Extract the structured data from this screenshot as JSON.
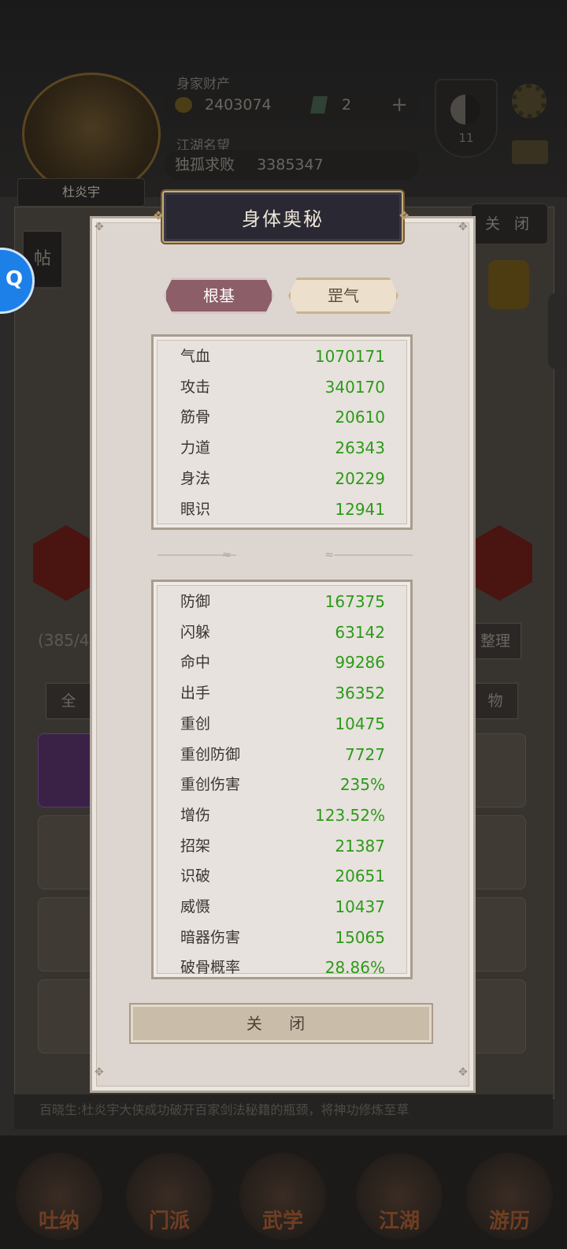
{
  "background": {
    "player_name": "杜炎宇",
    "wealth_label": "身家财产",
    "coins": "2403074",
    "gems": "2",
    "fame_label": "江湖名望",
    "fame_title": "独孤求败",
    "fame_value": "3385347",
    "level": "11",
    "close_label": "关 闭",
    "tie_label": "帖",
    "inventory_count": "(385/4",
    "sort_label": "整理",
    "tab_all": "全",
    "tab_items": "物",
    "ticker": "百晓生:杜炎宇大侠成功破开百家剑法秘籍的瓶颈，将神功修炼至草",
    "nav": [
      "吐纳",
      "门派",
      "武学",
      "江湖",
      "游历"
    ]
  },
  "modal": {
    "title": "身体奥秘",
    "tabs": [
      {
        "label": "根基",
        "active": true
      },
      {
        "label": "罡气",
        "active": false
      }
    ],
    "base_stats": [
      {
        "name": "气血",
        "value": "1070171"
      },
      {
        "name": "攻击",
        "value": "340170"
      },
      {
        "name": "筋骨",
        "value": "20610"
      },
      {
        "name": "力道",
        "value": "26343"
      },
      {
        "name": "身法",
        "value": "20229"
      },
      {
        "name": "眼识",
        "value": "12941"
      }
    ],
    "combat_stats": [
      {
        "name": "防御",
        "value": "167375"
      },
      {
        "name": "闪躲",
        "value": "63142"
      },
      {
        "name": "命中",
        "value": "99286"
      },
      {
        "name": "出手",
        "value": "36352"
      },
      {
        "name": "重创",
        "value": "10475"
      },
      {
        "name": "重创防御",
        "value": "7727"
      },
      {
        "name": "重创伤害",
        "value": "235%"
      },
      {
        "name": "增伤",
        "value": "123.52%"
      },
      {
        "name": "招架",
        "value": "21387"
      },
      {
        "name": "识破",
        "value": "20651"
      },
      {
        "name": "威慑",
        "value": "10437"
      },
      {
        "name": "暗器伤害",
        "value": "15065"
      },
      {
        "name": "破骨概率",
        "value": "28.86%"
      }
    ],
    "close_label": "关 闭"
  },
  "colors": {
    "value_green": "#2c9a19",
    "active_tab": "#8c5e68",
    "title_bg": "#2a2933"
  }
}
